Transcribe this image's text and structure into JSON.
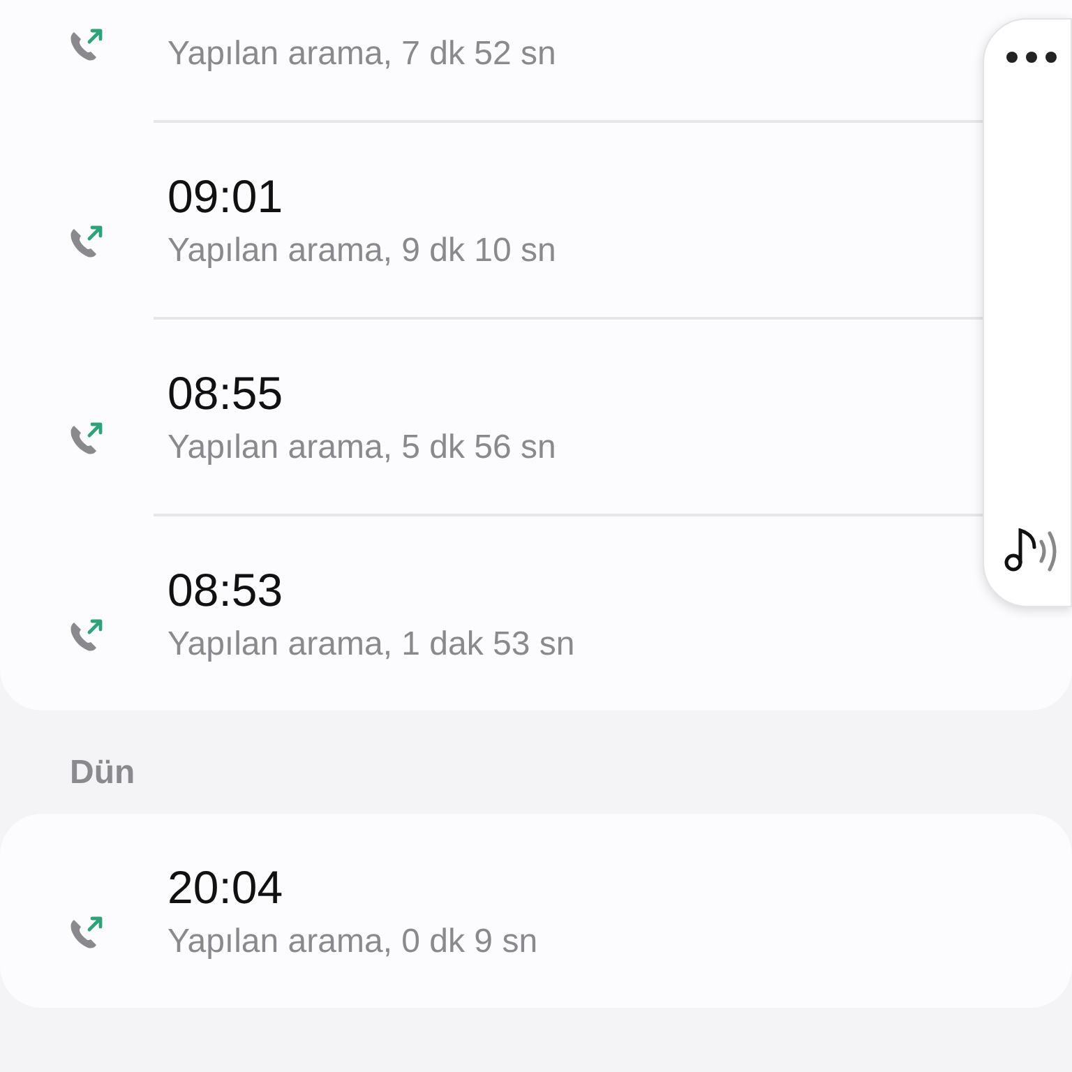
{
  "sections": [
    {
      "calls": [
        {
          "kind": "outgoing",
          "detail": "Yapılan arama, 7 dk 52 sn"
        },
        {
          "kind": "outgoing",
          "time": "09:01",
          "detail": "Yapılan arama, 9 dk 10 sn"
        },
        {
          "kind": "outgoing",
          "time": "08:55",
          "detail": "Yapılan arama, 5 dk 56 sn"
        },
        {
          "kind": "outgoing",
          "time": "08:53",
          "detail": "Yapılan arama, 1 dak 53 sn"
        }
      ]
    },
    {
      "label": "Dün",
      "calls": [
        {
          "kind": "outgoing",
          "time": "20:04",
          "detail": "Yapılan arama, 0 dk 9 sn"
        }
      ]
    }
  ]
}
